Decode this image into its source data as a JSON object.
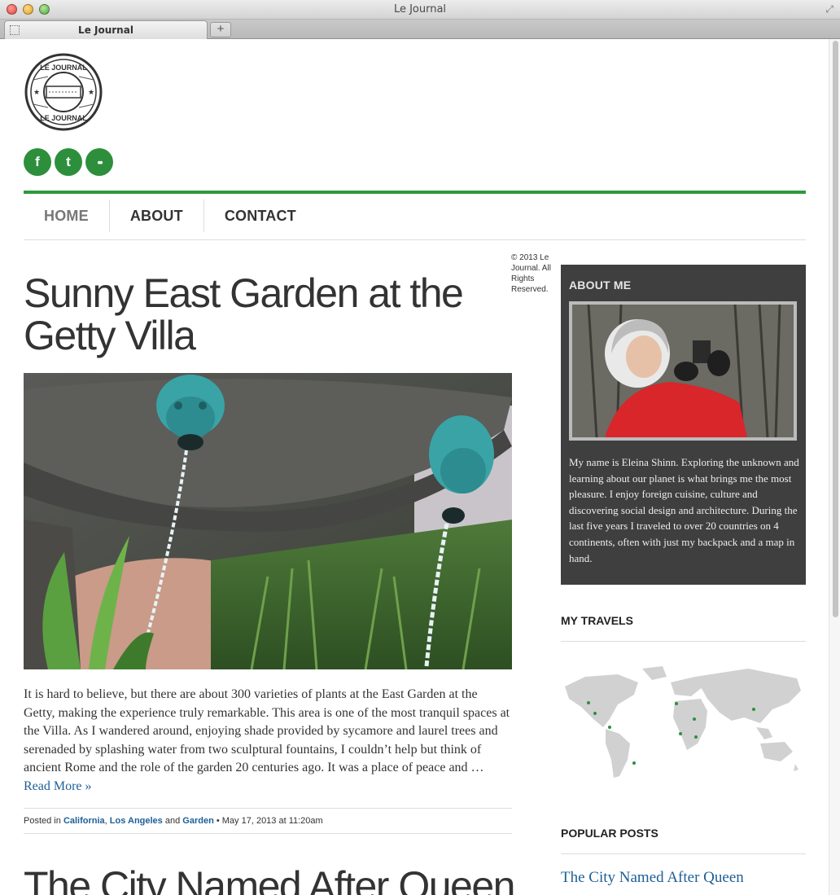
{
  "window": {
    "title": "Le Journal"
  },
  "tab": {
    "label": "Le Journal",
    "new_tab": "+"
  },
  "site": {
    "logo_text": "LE JOURNAL",
    "social": [
      {
        "glyph": "f",
        "icon": "facebook-icon"
      },
      {
        "glyph": "t",
        "icon": "twitter-icon"
      },
      {
        "glyph": "••",
        "icon": "flickr-icon"
      }
    ],
    "nav": [
      "HOME",
      "ABOUT",
      "CONTACT"
    ],
    "copyright": "© 2013 Le Journal. All Rights Reserved.",
    "accent_color": "#2d9a3f",
    "link_color": "#1d5f96"
  },
  "post": {
    "title": "Sunny East Garden at the Getty Villa",
    "excerpt": "It is hard to believe, but there are about 300 varieties of plants at the East Garden at the Getty, making the experience truly remarkable. This area is one of the most tranquil spaces at the Villa. As I wandered around, enjoying shade provided by sycamore and laurel trees and serenaded by splashing water from two sculptural fountains, I couldn’t help but think of ancient Rome and the role of the garden 20 centuries ago. It was a place of peace and …",
    "read_more": "Read More »",
    "meta": {
      "posted_in": "Posted in",
      "cat1": "California",
      "sep1": ",",
      "cat2": "Los Angeles",
      "and": "and",
      "cat3": "Garden",
      "date": "• May 17, 2013 at 11:20am"
    }
  },
  "next_post": {
    "title": "The City Named After Queen"
  },
  "sidebar": {
    "about": {
      "heading": "ABOUT ME",
      "text": "My name is Eleina Shinn. Exploring the unknown and learning about our planet is what brings me the most pleasure. I enjoy foreign cuisine, culture and discovering social design and architecture. During the last five years I traveled to over 20 countries on 4 continents, often with just my backpack and a map in hand."
    },
    "travels": {
      "heading": "MY TRAVELS"
    },
    "popular": {
      "heading": "POPULAR POSTS",
      "first_link": "The City Named After Queen"
    }
  }
}
